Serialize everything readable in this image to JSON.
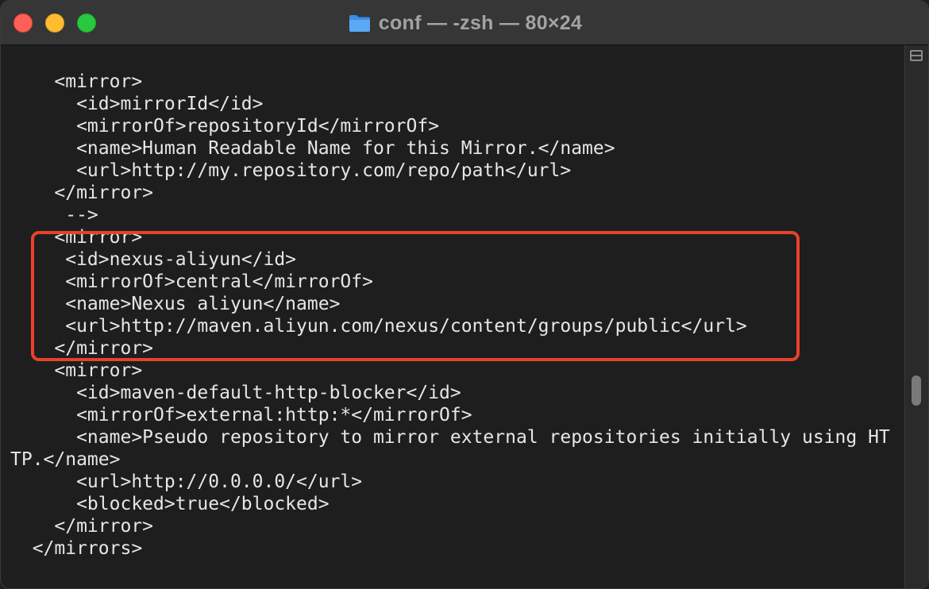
{
  "window": {
    "title": "conf — -zsh — 80×24"
  },
  "colors": {
    "highlight": "#e8412c",
    "text": "#e6e6e6",
    "background": "#1e1e1e"
  },
  "terminal": {
    "lines": [
      "    <mirror>",
      "      <id>mirrorId</id>",
      "      <mirrorOf>repositoryId</mirrorOf>",
      "      <name>Human Readable Name for this Mirror.</name>",
      "      <url>http://my.repository.com/repo/path</url>",
      "    </mirror>",
      "     -->",
      "    <mirror>",
      "     <id>nexus-aliyun</id>",
      "     <mirrorOf>central</mirrorOf>",
      "     <name>Nexus aliyun</name>",
      "     <url>http://maven.aliyun.com/nexus/content/groups/public</url>",
      "    </mirror>",
      "    <mirror>",
      "      <id>maven-default-http-blocker</id>",
      "      <mirrorOf>external:http:*</mirrorOf>",
      "      <name>Pseudo repository to mirror external repositories initially using HT",
      "TP.</name>",
      "      <url>http://0.0.0.0/</url>",
      "      <blocked>true</blocked>",
      "    </mirror>",
      "  </mirrors>"
    ]
  }
}
